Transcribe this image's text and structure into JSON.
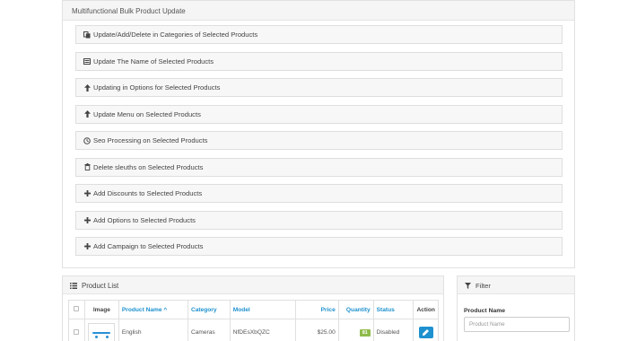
{
  "bulk": {
    "title": "Multifunctional Bulk Product Update",
    "items": [
      {
        "label": "Update/Add/Delete in Categories of Selected Products",
        "icon": "copy-icon"
      },
      {
        "label": "Update The Name of Selected Products",
        "icon": "list-icon"
      },
      {
        "label": "Updating in Options for Selected Products",
        "icon": "arrow-up-icon"
      },
      {
        "label": "Update Menu on Selected Products",
        "icon": "arrow-up-icon"
      },
      {
        "label": "Seo Processing on Selected Products",
        "icon": "clock-icon"
      },
      {
        "label": "Delete sleuths on Selected Products",
        "icon": "trash-icon"
      },
      {
        "label": "Add Discounts to Selected Products",
        "icon": "plus-icon"
      },
      {
        "label": "Add Options to Selected Products",
        "icon": "plus-icon"
      },
      {
        "label": "Add Campaign to Selected Products",
        "icon": "plus-icon"
      }
    ]
  },
  "product_list": {
    "title": "Product List",
    "columns": {
      "image": "Image",
      "name": "Product Name",
      "category": "Category",
      "model": "Model",
      "price": "Price",
      "quantity": "Quantity",
      "status": "Status",
      "action": "Action"
    },
    "sort_indicator": "^",
    "rows": [
      {
        "name": "English",
        "category": "Cameras",
        "model": "NfDEsXbQZC",
        "price": "$25.00",
        "quantity": "81",
        "status": "Disabled"
      }
    ]
  },
  "filter": {
    "title": "Filter",
    "product_name_label": "Product Name",
    "product_name_placeholder": "Product Name"
  },
  "colors": {
    "accent": "#1e91cf",
    "quantity_badge": "#8fbb4a"
  }
}
